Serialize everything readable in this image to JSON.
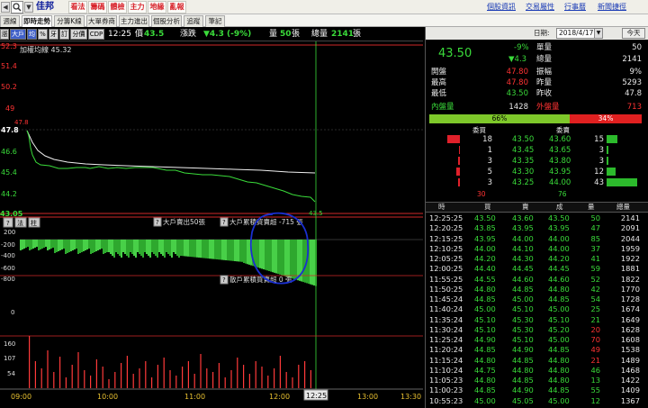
{
  "topbar": {
    "stock_name": "佳邦",
    "menu": [
      "看法",
      "籌碼",
      "體檢",
      "主力",
      "地緣",
      "亂報"
    ],
    "links": [
      "個股資訊",
      "交易屬性",
      "行事曆",
      "新聞捷徑"
    ]
  },
  "tabs": [
    "週線圖",
    "即時走勢",
    "分籌K線",
    "大單券商",
    "主力進出",
    "個股分析",
    "追蹤",
    "筆記"
  ],
  "chart_toolbar": {
    "buttons": [
      "漲",
      "大戶",
      "均",
      "%",
      "牙",
      "訂",
      "分價",
      "CDP"
    ],
    "time": "12:25",
    "price_label": "價",
    "price": "43.5",
    "change_label": "漲跌",
    "change": "▼4.3 (-9%)",
    "volume_label": "量",
    "volume": "50",
    "volume_unit": "張",
    "total_label": "總量",
    "total": "2141",
    "total_unit": "張"
  },
  "main_chart": {
    "legend": "加權均線 45.32",
    "y_ticks": [
      "52.3",
      "51.4",
      "50.2",
      "49",
      "47.8",
      "46.6",
      "45.4",
      "44.2",
      "43.05"
    ],
    "open_marker": "47.8",
    "last_marker": "43.5"
  },
  "flow_chart": {
    "buttons": [
      "?",
      "法",
      "柱"
    ],
    "q_mark": "?",
    "label_big_sell": "大戶賣出50張",
    "label_big_net": "大戶累積買賣超 -715 張",
    "label_small_net": "散戶累積買賣超 0 張",
    "y_ticks": [
      "200",
      "-200",
      "-400",
      "-600",
      "-800",
      "0"
    ]
  },
  "volume_chart": {
    "y_ticks": [
      "160",
      "107",
      "54"
    ]
  },
  "time_axis": {
    "labels": [
      "09:00",
      "10:00",
      "11:00",
      "12:00",
      "13:00",
      "13:30"
    ],
    "cursor": "12:25"
  },
  "right_panel": {
    "date_label": "日期:",
    "date": "2018/4/17",
    "today": "今天",
    "price": "43.50",
    "change_pct": "-9%",
    "change": "▼4.3",
    "stats": [
      {
        "label": "單量",
        "value": "50"
      },
      {
        "label": "總量",
        "value": "2141"
      },
      {
        "label": "開盤",
        "value": "47.80",
        "label2": "振幅",
        "value2": "9%"
      },
      {
        "label": "最高",
        "value": "47.80",
        "label2": "昨量",
        "value2": "5293"
      },
      {
        "label": "最低",
        "value": "43.50",
        "label2": "昨收",
        "value2": "47.8"
      }
    ],
    "inner_label": "內盤量",
    "inner_value": "1428",
    "outer_label": "外盤量",
    "outer_value": "713",
    "inner_pct": "66%",
    "outer_pct": "34%",
    "book_header": {
      "bid": "委買",
      "ask": "委賣"
    },
    "order_book": [
      {
        "bid_vol": 18,
        "bid": "43.50",
        "ask": "43.60",
        "ask_vol": 15
      },
      {
        "bid_vol": 1,
        "bid": "43.45",
        "ask": "43.65",
        "ask_vol": 3
      },
      {
        "bid_vol": 3,
        "bid": "43.35",
        "ask": "43.80",
        "ask_vol": 3
      },
      {
        "bid_vol": 5,
        "bid": "43.30",
        "ask": "43.95",
        "ask_vol": 12
      },
      {
        "bid_vol": 3,
        "bid": "43.25",
        "ask": "44.00",
        "ask_vol": 43
      }
    ],
    "book_totals": {
      "bid": "30",
      "ask": "76"
    },
    "tick_header": [
      "時",
      "買",
      "賣",
      "成",
      "量",
      "總量"
    ],
    "ticks": [
      {
        "time": "12:25:25",
        "bid": "43.50",
        "ask": "43.60",
        "price": "43.50",
        "vol": "50",
        "total": "2141",
        "vc": "g"
      },
      {
        "time": "12:20:25",
        "bid": "43.85",
        "ask": "43.95",
        "price": "43.95",
        "vol": "47",
        "total": "2091",
        "vc": "g"
      },
      {
        "time": "12:15:25",
        "bid": "43.95",
        "ask": "44.00",
        "price": "44.00",
        "vol": "85",
        "total": "2044",
        "vc": "g"
      },
      {
        "time": "12:10:25",
        "bid": "44.00",
        "ask": "44.10",
        "price": "44.00",
        "vol": "37",
        "total": "1959",
        "vc": "g"
      },
      {
        "time": "12:05:25",
        "bid": "44.20",
        "ask": "44.30",
        "price": "44.20",
        "vol": "41",
        "total": "1922",
        "vc": "g"
      },
      {
        "time": "12:00:25",
        "bid": "44.40",
        "ask": "44.45",
        "price": "44.45",
        "vol": "59",
        "total": "1881",
        "vc": "g"
      },
      {
        "time": "11:55:25",
        "bid": "44.55",
        "ask": "44.60",
        "price": "44.60",
        "vol": "52",
        "total": "1822",
        "vc": "g"
      },
      {
        "time": "11:50:25",
        "bid": "44.80",
        "ask": "44.85",
        "price": "44.80",
        "vol": "42",
        "total": "1770",
        "vc": "g"
      },
      {
        "time": "11:45:24",
        "bid": "44.85",
        "ask": "45.00",
        "price": "44.85",
        "vol": "54",
        "total": "1728",
        "vc": "g"
      },
      {
        "time": "11:40:24",
        "bid": "45.00",
        "ask": "45.10",
        "price": "45.00",
        "vol": "25",
        "total": "1674",
        "vc": "g"
      },
      {
        "time": "11:35:24",
        "bid": "45.10",
        "ask": "45.30",
        "price": "45.10",
        "vol": "21",
        "total": "1649",
        "vc": "g"
      },
      {
        "time": "11:30:24",
        "bid": "45.10",
        "ask": "45.30",
        "price": "45.20",
        "vol": "20",
        "total": "1628",
        "vc": "r"
      },
      {
        "time": "11:25:24",
        "bid": "44.90",
        "ask": "45.10",
        "price": "45.00",
        "vol": "70",
        "total": "1608",
        "vc": "r"
      },
      {
        "time": "11:20:24",
        "bid": "44.85",
        "ask": "44.90",
        "price": "44.85",
        "vol": "49",
        "total": "1538",
        "vc": "r"
      },
      {
        "time": "11:15:24",
        "bid": "44.80",
        "ask": "44.85",
        "price": "44.80",
        "vol": "21",
        "total": "1489",
        "vc": "r"
      },
      {
        "time": "11:10:24",
        "bid": "44.75",
        "ask": "44.80",
        "price": "44.80",
        "vol": "46",
        "total": "1468",
        "vc": "g"
      },
      {
        "time": "11:05:23",
        "bid": "44.80",
        "ask": "44.85",
        "price": "44.80",
        "vol": "13",
        "total": "1422",
        "vc": "g"
      },
      {
        "time": "11:00:23",
        "bid": "44.85",
        "ask": "44.90",
        "price": "44.85",
        "vol": "55",
        "total": "1409",
        "vc": "g"
      },
      {
        "time": "10:55:23",
        "bid": "45.00",
        "ask": "45.05",
        "price": "45.00",
        "vol": "12",
        "total": "1367",
        "vc": "g"
      }
    ]
  },
  "colors": {
    "up": "#ff3333",
    "down": "#3adb3a",
    "bg": "#000000",
    "annotation": "#1a2fd0"
  }
}
